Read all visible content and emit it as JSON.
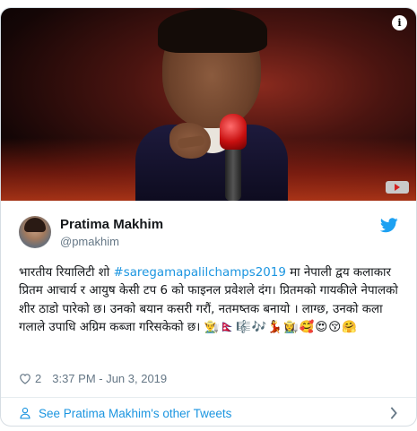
{
  "tweet": {
    "author_name": "Pratima Makhim",
    "author_handle": "@pmakhim",
    "text_before": "भारतीय रियालिटी शो ",
    "hashtag": "#saregamapalilchamps2019",
    "text_after": " मा नेपाली द्वय कलाकार प्रितम आचार्य र आयुष केसी टप 6 को फाइनल प्रवेशले दंग। प्रितमको गायकीले नेपालको शीर ठाडो पारेको छ। उनको बयान कसरी गरौं, नतमष्तक बनायो । लाग्छ, उनको कला गलाले उपाधि अग्रिम कब्जा गरिसकेको छ। ",
    "emojis": "👨‍🌾🇳🇵🎼🎶💃👩‍🌾🥰😍😚🤗",
    "like_count": "2",
    "timestamp": "3:37 PM - Jun 3, 2019"
  },
  "footer": {
    "see_more_label": "See Pratima Makhim's other Tweets"
  },
  "icons": {
    "info": "info-icon",
    "twitter": "twitter-bird-icon",
    "like": "heart-icon",
    "profile": "person-icon",
    "next": "chevron-right-icon"
  },
  "colors": {
    "link": "#1b95e0",
    "secondary_text": "#657786",
    "border": "#d6dde3"
  }
}
